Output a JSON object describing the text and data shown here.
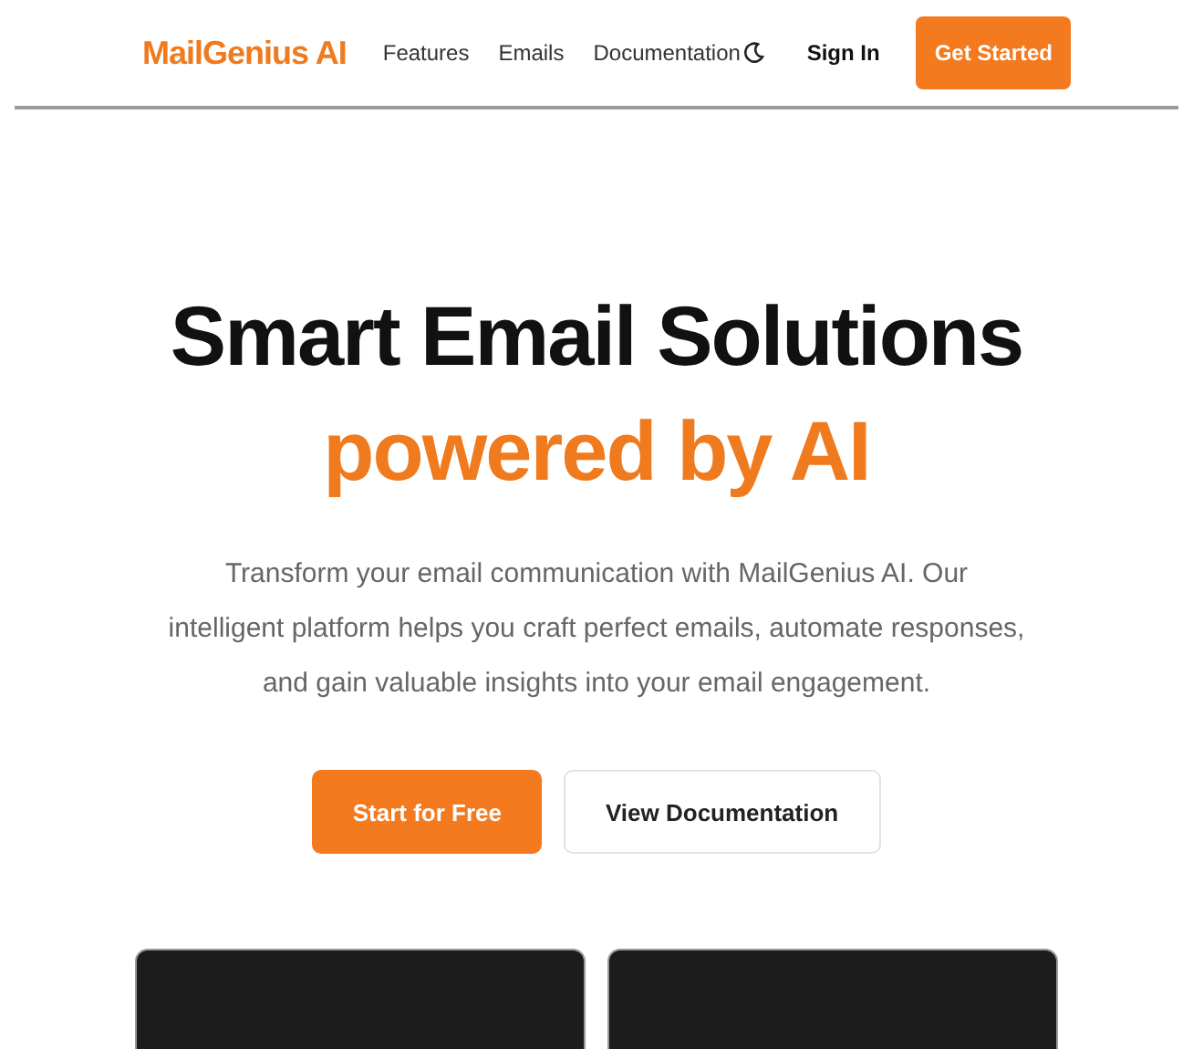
{
  "header": {
    "logo": "MailGenius AI",
    "nav": [
      {
        "label": "Features"
      },
      {
        "label": "Emails"
      },
      {
        "label": "Documentation"
      }
    ],
    "sign_in": "Sign In",
    "cta": "Get Started"
  },
  "hero": {
    "title": "Smart Email Solutions",
    "highlight": "powered by AI",
    "description": "Transform your email communication with MailGenius AI. Our intelligent platform helps you craft perfect emails, automate responses, and gain valuable insights into your email engagement.",
    "buttons": [
      {
        "label": "Start for Free",
        "kind": "primary"
      },
      {
        "label": "View Documentation",
        "kind": "secondary"
      }
    ]
  },
  "cards": [
    {
      "kind": "panel"
    },
    {
      "kind": "panel"
    }
  ]
}
